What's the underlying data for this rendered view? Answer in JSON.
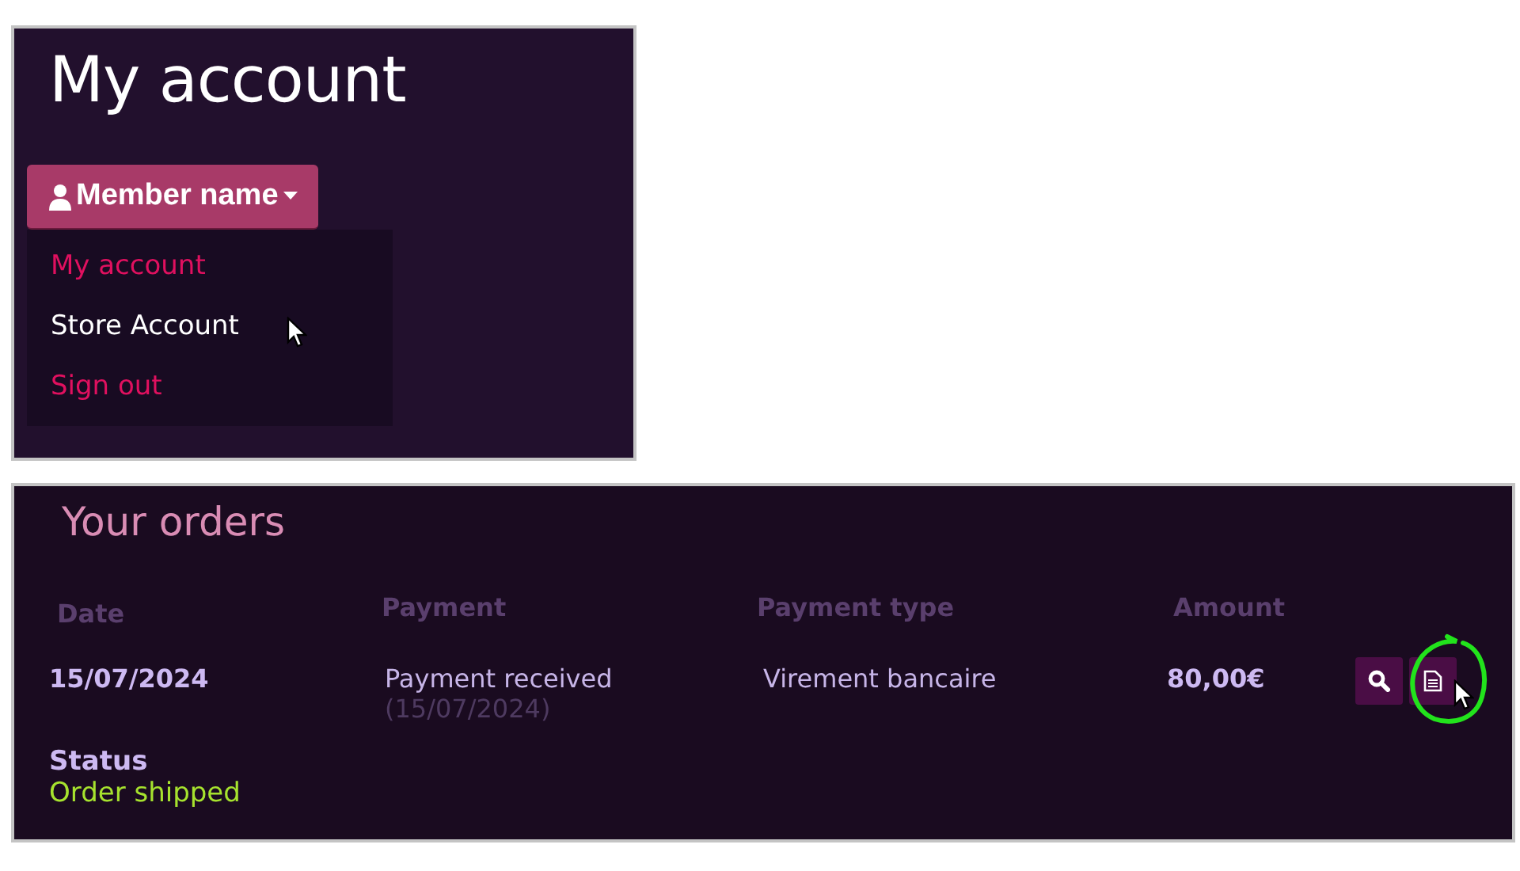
{
  "account": {
    "title": "My account",
    "member_button": "Member name",
    "menu": [
      {
        "label": "My account",
        "selected": false
      },
      {
        "label": "Store Account",
        "selected": true
      },
      {
        "label": "Sign out",
        "selected": false
      }
    ]
  },
  "orders": {
    "title": "Your orders",
    "columns": [
      "Date",
      "Payment",
      "Payment type",
      "Amount"
    ],
    "rows": [
      {
        "date": "15/07/2024",
        "payment": "Payment received",
        "payment_date": "(15/07/2024)",
        "payment_type": "Virement bancaire",
        "amount": "80,00€",
        "status_label": "Status",
        "status": "Order shipped"
      }
    ]
  }
}
